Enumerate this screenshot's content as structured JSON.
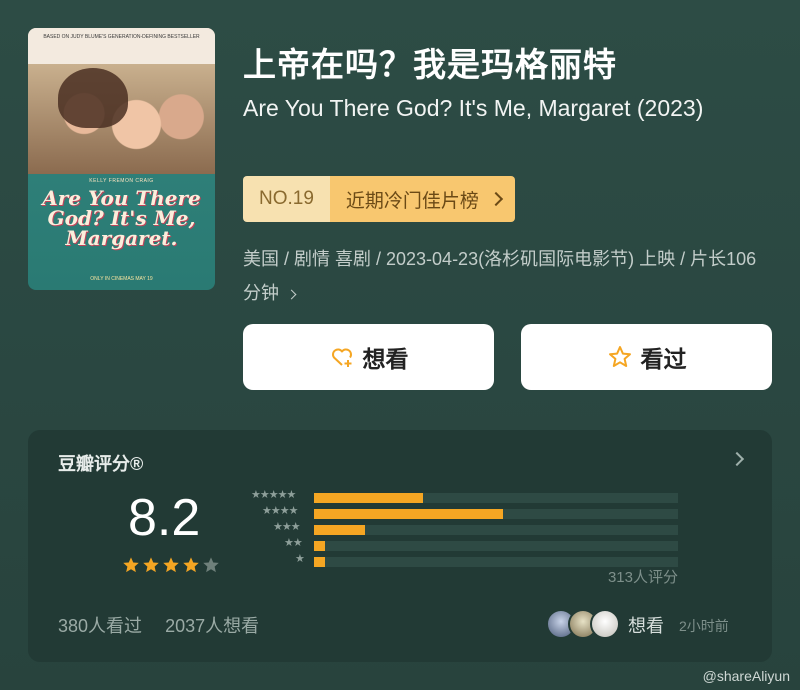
{
  "movie": {
    "title_cn": "上帝在吗？我是玛格丽特",
    "title_en": "Are You There God? It's Me, Margaret (2023)",
    "poster": {
      "tagline_top": "BASED ON JUDY BLUME'S GENERATION-DEFINING BESTSELLER",
      "title_art": "Are You There God? It's Me, Margaret.",
      "credit": "KELLY FREMON CRAIG",
      "bottom": "ONLY IN CINEMAS MAY 19"
    },
    "rank": {
      "number": "NO.19",
      "list_name": "近期冷门佳片榜"
    },
    "info": "美国 / 剧情 喜剧 / 2023-04-23(洛杉矶国际电影节) 上映 / 片长106分钟"
  },
  "actions": {
    "want_label": "想看",
    "seen_label": "看过"
  },
  "rating": {
    "section_title": "豆瓣评分®",
    "score": "8.2",
    "star_count": 4,
    "votes_label": "313人评分",
    "distribution": [
      {
        "stars": "★★★★★",
        "percent": 30
      },
      {
        "stars": "★★★★",
        "percent": 52
      },
      {
        "stars": "★★★",
        "percent": 14
      },
      {
        "stars": "★★",
        "percent": 3
      },
      {
        "stars": "★",
        "percent": 3
      }
    ],
    "seen_count": "380人看过",
    "want_count": "2037人想看",
    "friends_action": "想看",
    "friends_time": "2小时前"
  },
  "watermark": "@shareAliyun",
  "colors": {
    "background": "#2d4c45",
    "accent": "#f5a623",
    "rank_badge": "#f8c76f"
  },
  "icons": {
    "want": "heart-plus-icon",
    "seen": "star-outline-icon"
  }
}
